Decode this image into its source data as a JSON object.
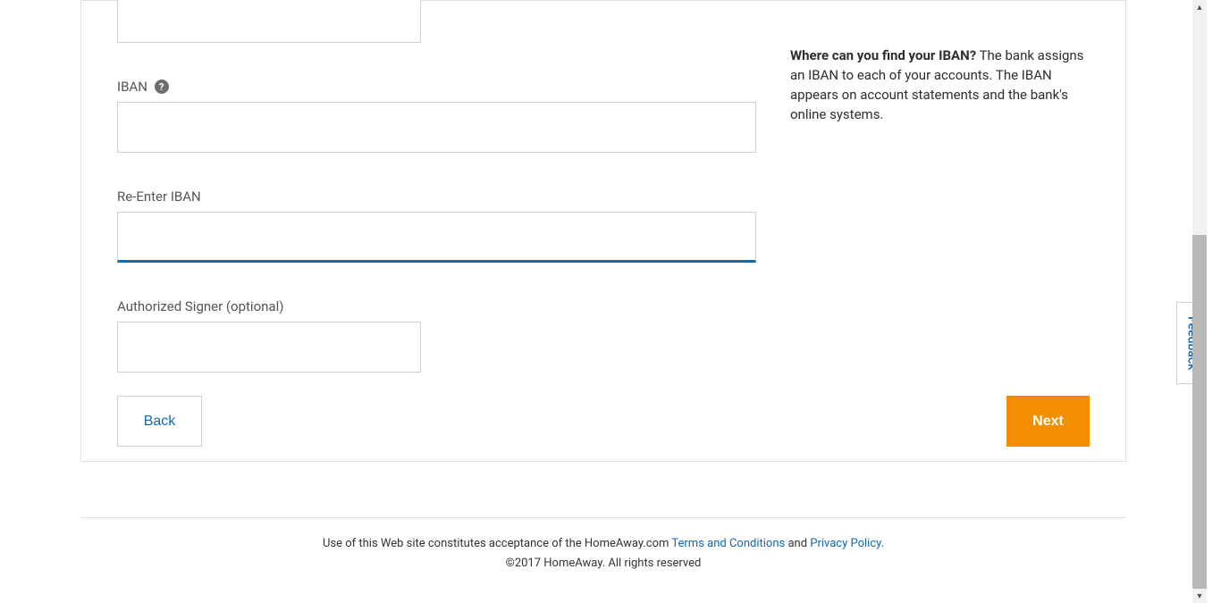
{
  "form": {
    "iban_label": "IBAN",
    "reenter_iban_label": "Re-Enter IBAN",
    "signer_label": "Authorized Signer (optional)",
    "iban_value": "",
    "reenter_iban_value": "",
    "signer_value": "",
    "top_input_value": ""
  },
  "help": {
    "heading": "Where can you find your IBAN?",
    "body": " The bank assigns an IBAN to each of your accounts. The IBAN appears on account statements and the bank's online systems."
  },
  "actions": {
    "back": "Back",
    "next": "Next"
  },
  "footer": {
    "prefix": "Use of this Web site constitutes acceptance of the HomeAway.com ",
    "terms": "Terms and Conditions",
    "and": " and ",
    "privacy": "Privacy Policy",
    "period": ".",
    "copyright": "©2017 HomeAway. All rights reserved"
  },
  "feedback": "Feedback",
  "icons": {
    "help_glyph": "?"
  }
}
